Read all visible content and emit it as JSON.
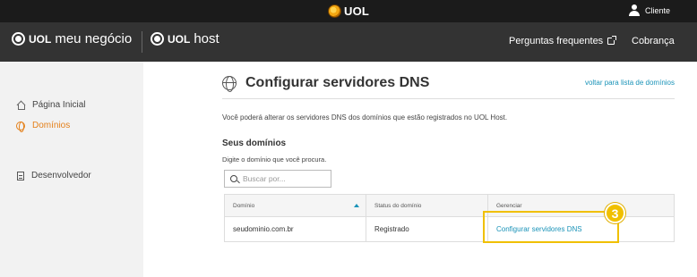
{
  "topbar": {
    "logo_text": "UOL",
    "user_label": "Cliente"
  },
  "navbar": {
    "brand1_logo": "UOL",
    "brand1_name": "meu negócio",
    "brand2_logo": "UOL",
    "brand2_name": "host",
    "faq_label": "Perguntas frequentes",
    "billing_label": "Cobrança"
  },
  "sidebar": {
    "items": [
      {
        "label": "Página Inicial",
        "icon": "home-icon"
      },
      {
        "label": "Domínios",
        "icon": "globe-icon",
        "active": true
      },
      {
        "label": "Desenvolvedor",
        "icon": "document-icon"
      }
    ]
  },
  "main": {
    "title": "Configurar servidores DNS",
    "back_link": "voltar para lista de domínios",
    "intro": "Você poderá alterar os servidores DNS dos domínios que estão registrados no UOL Host.",
    "section_title": "Seus domínios",
    "hint": "Digite o domínio que você procura.",
    "search_placeholder": "Buscar por..."
  },
  "table": {
    "headers": [
      "Domínio",
      "Status do domínio",
      "Gerenciar"
    ],
    "rows": [
      {
        "domain": "seudominio.com.br",
        "status": "Registrado",
        "action": "Configurar servidores DNS"
      }
    ]
  },
  "annotation": {
    "step": "3",
    "color": "#f0c000"
  },
  "colors": {
    "accent_orange": "#e4801a",
    "link_blue": "#1a93b8",
    "topbar": "#1b1b1b",
    "navbar": "#333333"
  }
}
